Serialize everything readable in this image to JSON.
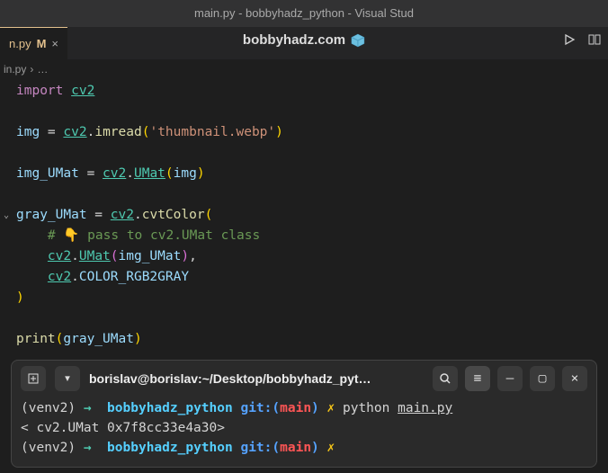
{
  "title": "main.py - bobbyhadz_python - Visual Stud",
  "tab": {
    "name": "n.py",
    "modified": "M",
    "close": "×"
  },
  "watermark": {
    "text": "bobbyhadz.com"
  },
  "breadcrumb": {
    "file": "in.py",
    "sep": "›",
    "more": "…"
  },
  "code": {
    "l1_import": "import",
    "l1_mod": "cv2",
    "l3_var": "img",
    "l3_eq": " = ",
    "l3_mod": "cv2",
    "l3_dot": ".",
    "l3_fn": "imread",
    "l3_str": "'thumbnail.webp'",
    "l5_var": "img_UMat",
    "l5_mod": "cv2",
    "l5_umat": "UMat",
    "l5_arg": "img",
    "l7_var": "gray_UMat",
    "l7_mod": "cv2",
    "l7_fn": "cvtColor",
    "l8_comment": "# 👇 pass to cv2.UMat class",
    "l9_mod": "cv2",
    "l9_umat": "UMat",
    "l9_arg": "img_UMat",
    "l9_comma": ",",
    "l10_mod": "cv2",
    "l10_const": "COLOR_RGB2GRAY",
    "l13_fn": "print",
    "l13_arg": "gray_UMat"
  },
  "terminal": {
    "cwd": "borislav@borislav:~/Desktop/bobbyhadz_pyt…",
    "line1": {
      "venv": "(venv2)",
      "arrow": "→",
      "path": "bobbyhadz_python",
      "git": "git:(",
      "branch": "main",
      "gitc": ")",
      "bolt": "✗",
      "cmd": "python",
      "file": "main.py"
    },
    "output": "< cv2.UMat 0x7f8cc33e4a30>",
    "line2": {
      "venv": "(venv2)",
      "arrow": "→",
      "path": "bobbyhadz_python",
      "git": "git:(",
      "branch": "main",
      "gitc": ")",
      "bolt": "✗"
    }
  }
}
